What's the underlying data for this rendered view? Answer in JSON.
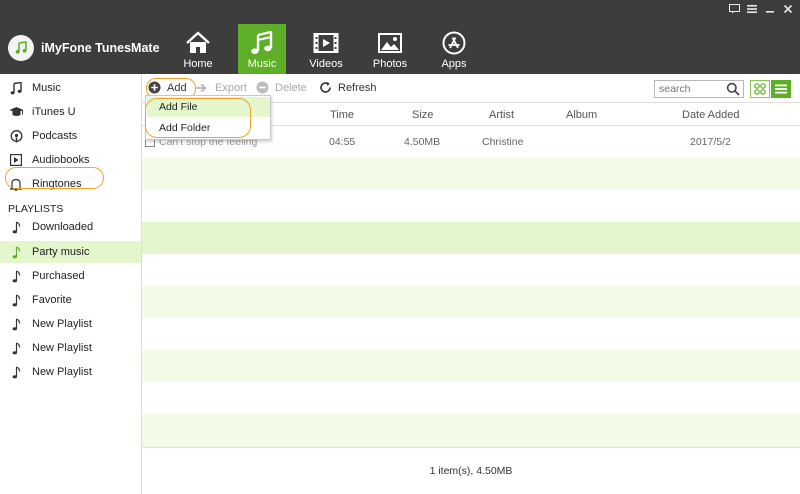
{
  "app": {
    "title": "iMyFone TunesMate"
  },
  "window_controls": [
    "feedback-icon",
    "menu-icon",
    "minimize-icon",
    "close-icon"
  ],
  "nav": {
    "tabs": [
      {
        "label": "Home",
        "icon": "home-icon",
        "active": false
      },
      {
        "label": "Music",
        "icon": "music-note-icon",
        "active": true
      },
      {
        "label": "Videos",
        "icon": "film-icon",
        "active": false
      },
      {
        "label": "Photos",
        "icon": "photo-icon",
        "active": false
      },
      {
        "label": "Apps",
        "icon": "app-store-icon",
        "active": false
      }
    ]
  },
  "sidebar": {
    "items": [
      {
        "label": "Music",
        "icon": "music-note-icon"
      },
      {
        "label": "iTunes U",
        "icon": "graduation-cap-icon"
      },
      {
        "label": "Podcasts",
        "icon": "podcast-icon"
      },
      {
        "label": "Audiobooks",
        "icon": "audiobook-icon"
      },
      {
        "label": "Ringtones",
        "icon": "bell-icon"
      }
    ],
    "playlists_header": "PLAYLISTS",
    "playlists": [
      {
        "label": "Downloaded",
        "selected": false
      },
      {
        "label": "Party music",
        "selected": true
      },
      {
        "label": "Purchased",
        "selected": false
      },
      {
        "label": "Favorite",
        "selected": false
      },
      {
        "label": "New Playlist",
        "selected": false
      },
      {
        "label": "New Playlist",
        "selected": false
      },
      {
        "label": "New Playlist",
        "selected": false
      }
    ]
  },
  "toolbar": {
    "add_label": "Add",
    "export_label": "Export",
    "delete_label": "Delete",
    "refresh_label": "Refresh",
    "search_placeholder": "search"
  },
  "add_menu": {
    "items": [
      "Add File",
      "Add Folder"
    ],
    "hovered": "Add File"
  },
  "table": {
    "columns": [
      "Time",
      "Size",
      "Artist",
      "Album",
      "Date Added"
    ],
    "rows": [
      {
        "name": "Can't stop the feeling",
        "time": "04:55",
        "size": "4.50MB",
        "artist": "Christine",
        "album": "",
        "date_added": "2017/5/2"
      }
    ]
  },
  "status": {
    "text": "1 item(s), 4.50MB"
  },
  "colors": {
    "accent": "#5fae28",
    "row_alt": "#f1fbe6",
    "row_highlight": "#e4f6cc",
    "annotation": "#f2a228",
    "header_bg": "#3d3d3d"
  }
}
